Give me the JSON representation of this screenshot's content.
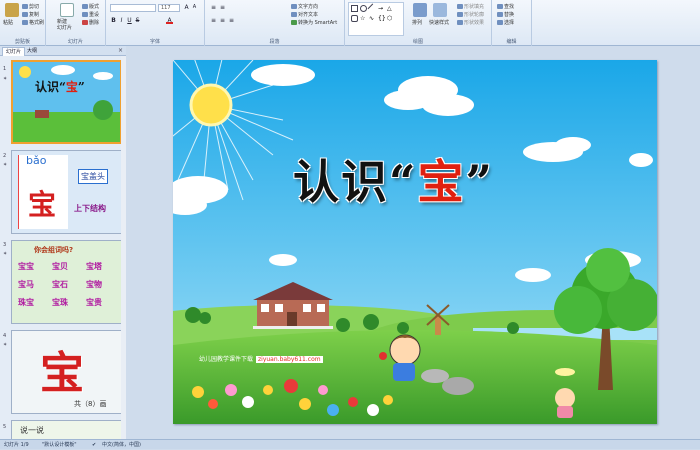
{
  "ribbon": {
    "groups": {
      "clipboard": "剪贴板",
      "slides": "幻灯片",
      "font": "字体",
      "paragraph": "段落",
      "drawing": "绘图",
      "editing": "编辑"
    },
    "clipboard": {
      "paste": "粘贴",
      "cut": "剪切",
      "copy": "复制",
      "format_painter": "格式刷"
    },
    "slides": {
      "new_slide": "新建\n幻灯片",
      "layout": "版式",
      "reset": "重设",
      "delete": "删除"
    },
    "font": {
      "size": "117"
    },
    "paragraph": {
      "text_direction": "文字方向",
      "align_text": "对齐文本",
      "smartart": "转换为 SmartArt"
    },
    "drawing": {
      "arrange": "排列",
      "quick_styles": "快速样式",
      "shape_fill": "形状填充",
      "shape_outline": "形状轮廓",
      "shape_effects": "形状效果"
    },
    "editing": {
      "find": "查找",
      "replace": "替换",
      "select": "选择"
    }
  },
  "panel": {
    "tabs": [
      "幻灯片",
      "大纲"
    ],
    "close": "×",
    "slides": [
      {
        "num": "1",
        "title": "认识“宝”"
      },
      {
        "num": "2",
        "pinyin": "bǎo",
        "char": "宝",
        "tag": "宝盖头",
        "structure": "上下结构"
      },
      {
        "num": "3",
        "question": "你会组词吗?",
        "words": [
          "宝宝",
          "宝贝",
          "宝塔",
          "宝马",
          "宝石",
          "宝物",
          "珠宝",
          "宝珠",
          "宝贵"
        ]
      },
      {
        "num": "4",
        "char": "宝",
        "strokes": "共（8）画"
      },
      {
        "num": "5",
        "text": "说一说"
      }
    ]
  },
  "slide": {
    "title_black": "认识“",
    "title_red": "宝",
    "title_end": "”",
    "watermark_text": "幼儿园教学课件下载",
    "watermark_url": "ziyuan.baby611.com"
  },
  "status": {
    "slide_count": "幻灯片 1/9",
    "theme": "\"默认设计模板\"",
    "language": "中文(简体，中国)"
  }
}
